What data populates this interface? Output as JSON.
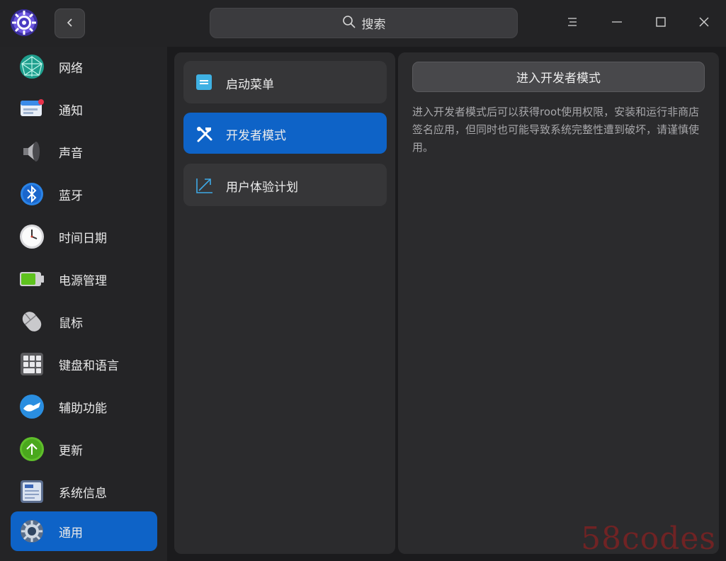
{
  "titlebar": {
    "app_icon": "control-center-gear-icon",
    "back_icon": "chevron-left-icon",
    "search": {
      "label": "搜索",
      "icon": "search-icon"
    },
    "window_controls": [
      "menu-icon",
      "minimize-icon",
      "maximize-icon",
      "close-icon"
    ]
  },
  "sidebar": {
    "items": [
      {
        "label": "网络",
        "icon": "network-icon"
      },
      {
        "label": "通知",
        "icon": "notification-icon"
      },
      {
        "label": "声音",
        "icon": "sound-icon"
      },
      {
        "label": "蓝牙",
        "icon": "bluetooth-icon"
      },
      {
        "label": "时间日期",
        "icon": "clock-icon"
      },
      {
        "label": "电源管理",
        "icon": "battery-icon"
      },
      {
        "label": "鼠标",
        "icon": "mouse-icon"
      },
      {
        "label": "键盘和语言",
        "icon": "keyboard-icon"
      },
      {
        "label": "辅助功能",
        "icon": "accessibility-icon"
      },
      {
        "label": "更新",
        "icon": "update-icon"
      },
      {
        "label": "系统信息",
        "icon": "system-info-icon"
      },
      {
        "label": "通用",
        "icon": "general-gear-icon",
        "active": true
      }
    ]
  },
  "middle": {
    "items": [
      {
        "label": "启动菜单",
        "icon": "boot-menu-icon"
      },
      {
        "label": "开发者模式",
        "icon": "tools-icon",
        "active": true
      },
      {
        "label": "用户体验计划",
        "icon": "trend-arrow-icon"
      }
    ]
  },
  "right": {
    "button_label": "进入开发者模式",
    "description": "进入开发者模式后可以获得root使用权限，安装和运行非商店签名应用，但同时也可能导致系统完整性遭到破坏，请谨慎使用。"
  },
  "watermark": "58codes",
  "colors": {
    "accent": "#0e63c7",
    "background": "#1b1b1d",
    "panel": "#2b2b2d"
  }
}
